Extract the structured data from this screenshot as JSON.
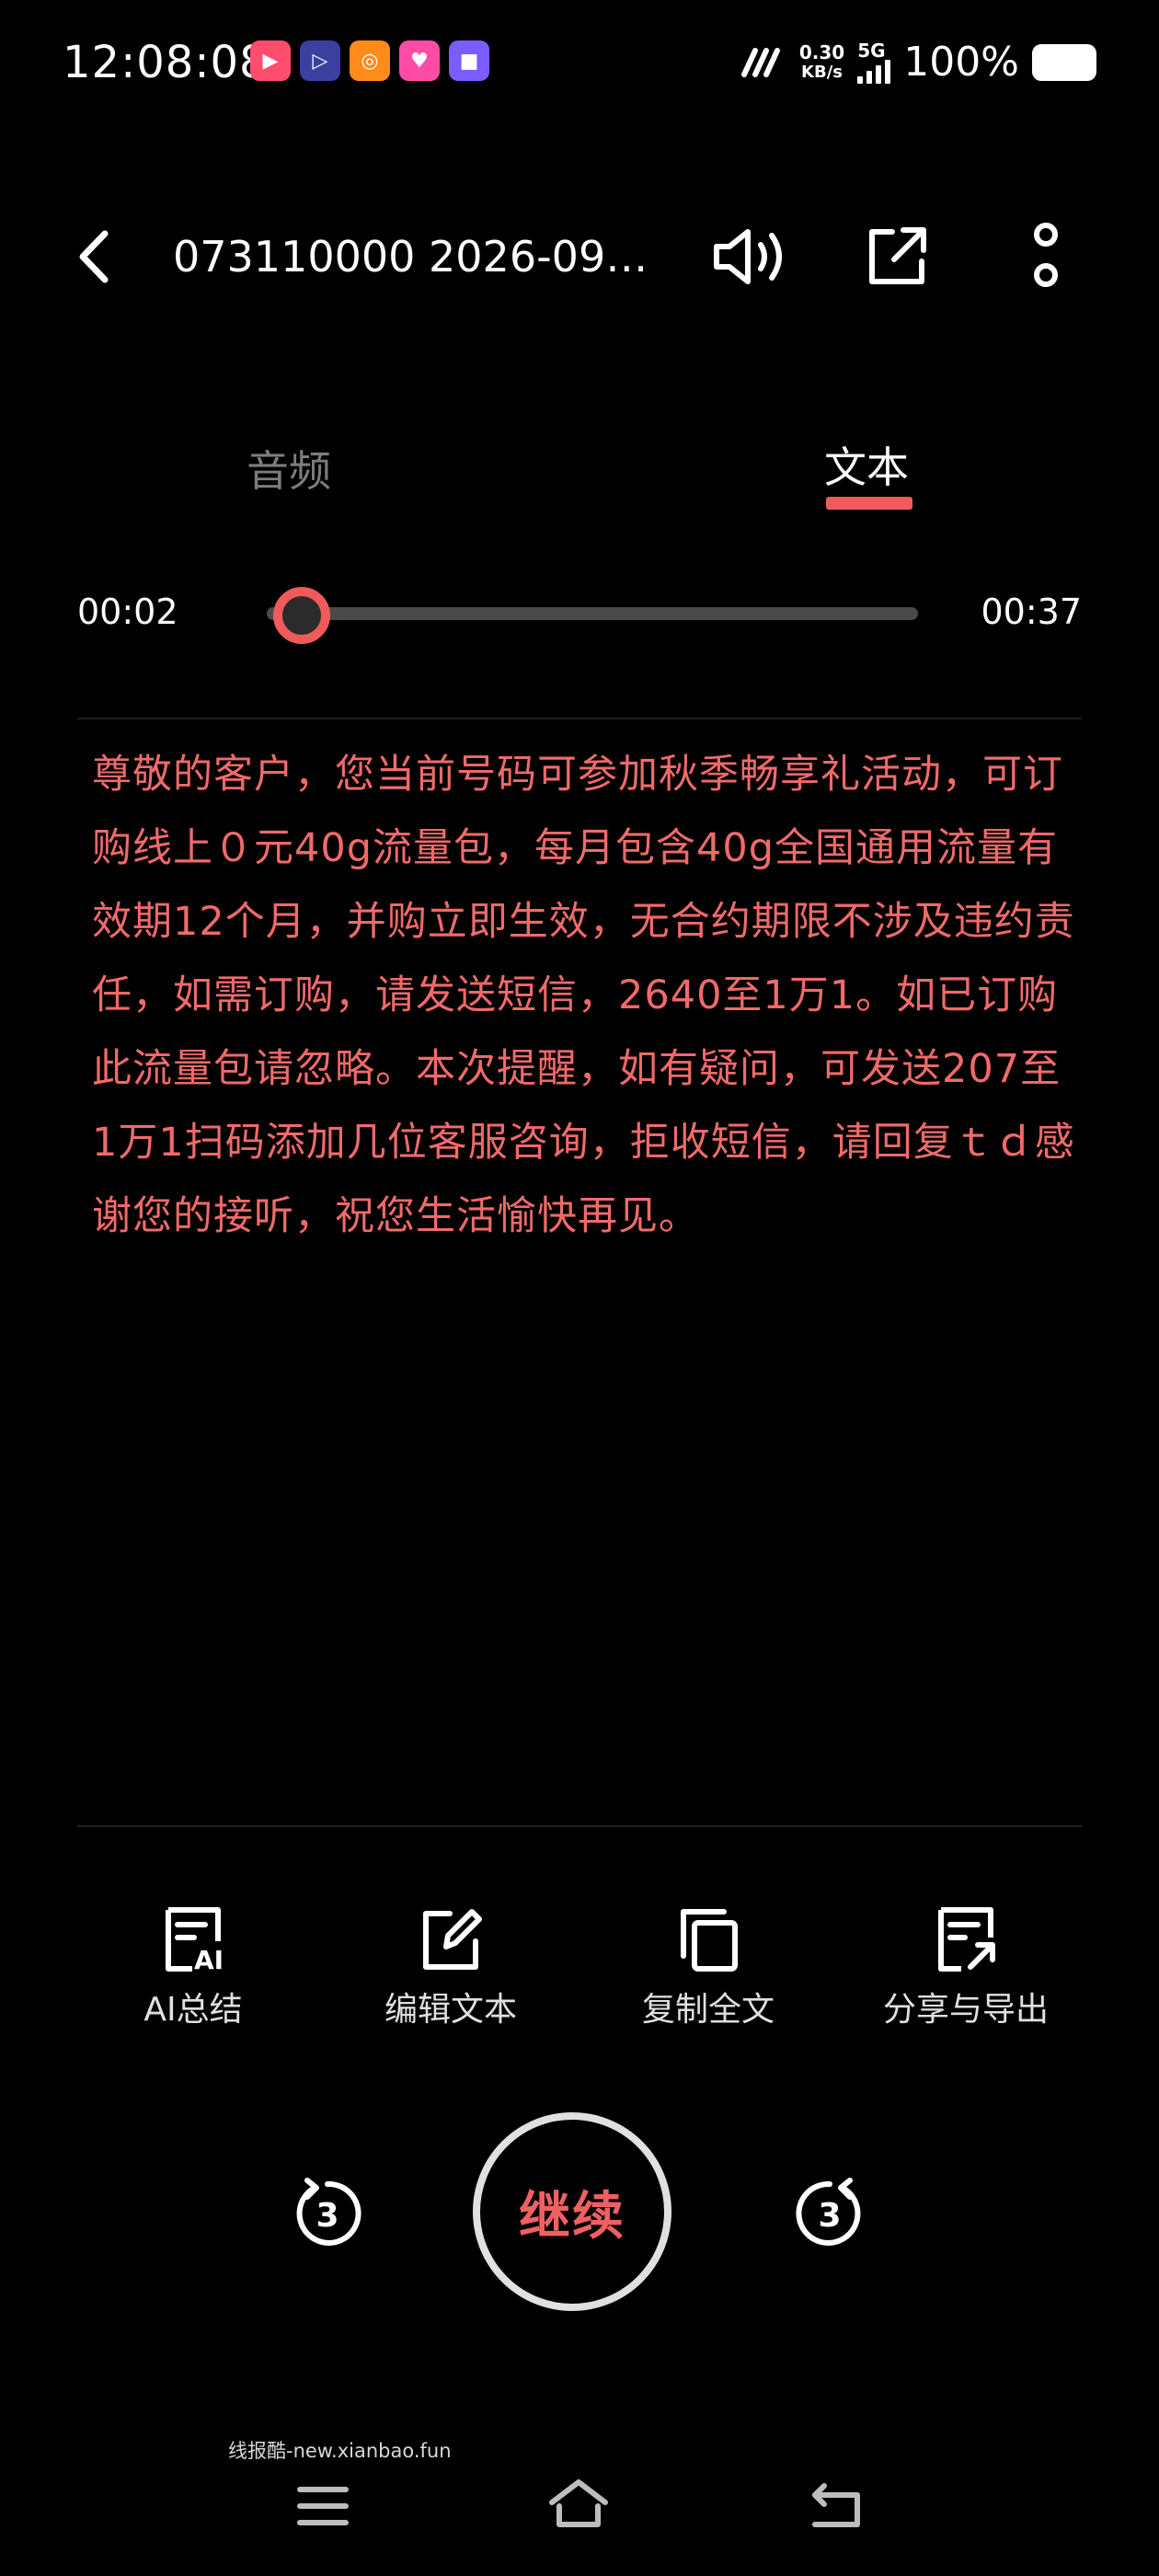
{
  "status_bar": {
    "time": "12:08:08",
    "net_speed_value": "0.30",
    "net_speed_unit": "KB/s",
    "network_type": "5G",
    "battery_percent": "100%",
    "app_badges": [
      {
        "icon": "video-app-icon",
        "color": "#ff4d6d"
      },
      {
        "icon": "player-app-icon",
        "color": "#3b3f9e"
      },
      {
        "icon": "shopping-app-icon",
        "color": "#ff8c1a"
      },
      {
        "icon": "social-app-icon",
        "color": "#ff4da6"
      },
      {
        "icon": "sticker-app-icon",
        "color": "#7a5cff"
      }
    ]
  },
  "header": {
    "title": "073110000 2026-09…"
  },
  "tabs": {
    "audio": "音频",
    "text": "文本",
    "active": "text"
  },
  "player": {
    "current_time": "00:02",
    "total_time": "00:37",
    "progress": 0.054,
    "play_label": "继续",
    "skip_back_seconds": "3",
    "skip_forward_seconds": "3"
  },
  "transcript": {
    "text": "尊敬的客户，您当前号码可参加秋季畅享礼活动，可订购线上０元40g流量包，每月包含40g全国通用流量有效期12个月，并购立即生效，无合约期限不涉及违约责任，如需订购，请发送短信，2640至1万1。如已订购此流量包请忽略。本次提醒，如有疑问，可发送207至1万1扫码添加几位客服咨询，拒收短信，请回复ｔｄ感谢您的接听，祝您生活愉快再见。"
  },
  "actions": {
    "ai_summary": "AI总结",
    "edit_text": "编辑文本",
    "copy_all": "复制全文",
    "share_export": "分享与导出"
  },
  "watermark": "线报酷-new.xianbao.fun",
  "colors": {
    "accent": "#f05a5a",
    "background": "#000000"
  }
}
